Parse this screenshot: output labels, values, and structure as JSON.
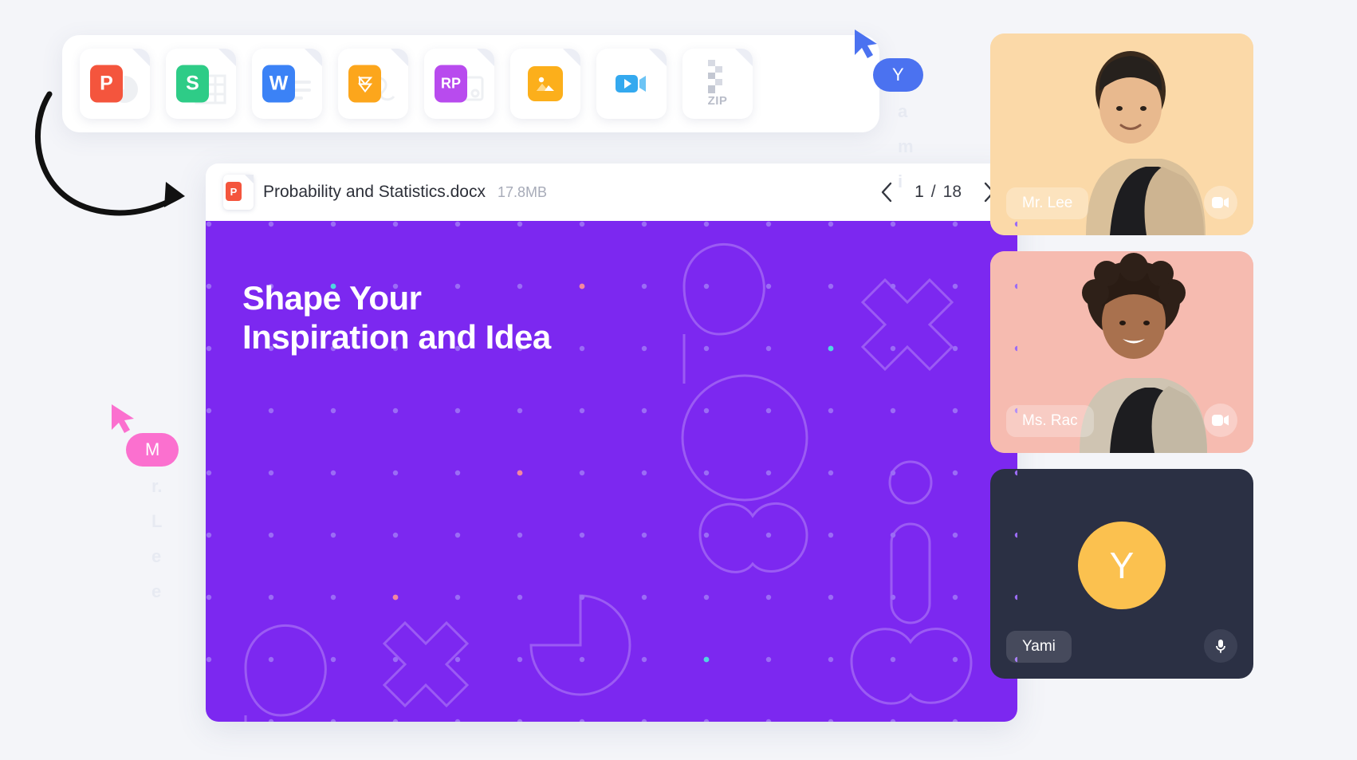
{
  "file_toolbar": {
    "name": "file-type-toolbar",
    "items": [
      {
        "icon": "ppt-file-icon",
        "label": "P",
        "color": "#f4553d",
        "kind": "presentation"
      },
      {
        "icon": "sheet-file-icon",
        "label": "S",
        "color": "#2ecc87",
        "kind": "spreadsheet"
      },
      {
        "icon": "word-file-icon",
        "label": "W",
        "color": "#3b82f6",
        "kind": "document"
      },
      {
        "icon": "sketch-file-icon",
        "label": "",
        "color": "#fca61c",
        "kind": "design"
      },
      {
        "icon": "rp-file-icon",
        "label": "RP",
        "color": "#b84bee",
        "kind": "prototype"
      },
      {
        "icon": "image-file-icon",
        "label": "",
        "color": "#fcaf1b",
        "kind": "image"
      },
      {
        "icon": "video-file-icon",
        "label": "",
        "color": "#34a9ef",
        "kind": "video"
      },
      {
        "icon": "zip-file-icon",
        "label": "ZIP",
        "color": "#b9bdc9",
        "kind": "archive"
      }
    ]
  },
  "document": {
    "file_icon": "ppt-file-icon",
    "file_badge": "P",
    "title": "Probability and Statistics.docx",
    "size": "17.8MB",
    "pager": {
      "prev_icon": "chevron-left-icon",
      "next_icon": "chevron-right-icon",
      "current_page": "1",
      "separator": "/",
      "total_pages": "18"
    },
    "slide": {
      "background": "#7c28f0",
      "title_line1": "Shape Your",
      "title_line2": "Inspiration and Idea"
    }
  },
  "participants": [
    {
      "name": "Mr. Lee",
      "tile_color": "#fbd9a8",
      "media_icon": "video-camera-icon",
      "avatar_letter": "",
      "type": "video"
    },
    {
      "name": "Ms. Rac",
      "tile_color": "#f6bbb0",
      "media_icon": "video-camera-icon",
      "avatar_letter": "",
      "type": "video"
    },
    {
      "name": "Yami",
      "tile_color": "#2b3044",
      "media_icon": "microphone-icon",
      "avatar_letter": "Y",
      "type": "avatar"
    }
  ],
  "cursors": [
    {
      "id": "cursor-mr-lee",
      "label": "M",
      "color": "#fb70cf",
      "trail": [
        "r.",
        "L",
        "e",
        "e"
      ]
    },
    {
      "id": "cursor-yami",
      "label": "Y",
      "color": "#4b72f0",
      "trail": [
        "a",
        "m",
        "i"
      ]
    }
  ]
}
